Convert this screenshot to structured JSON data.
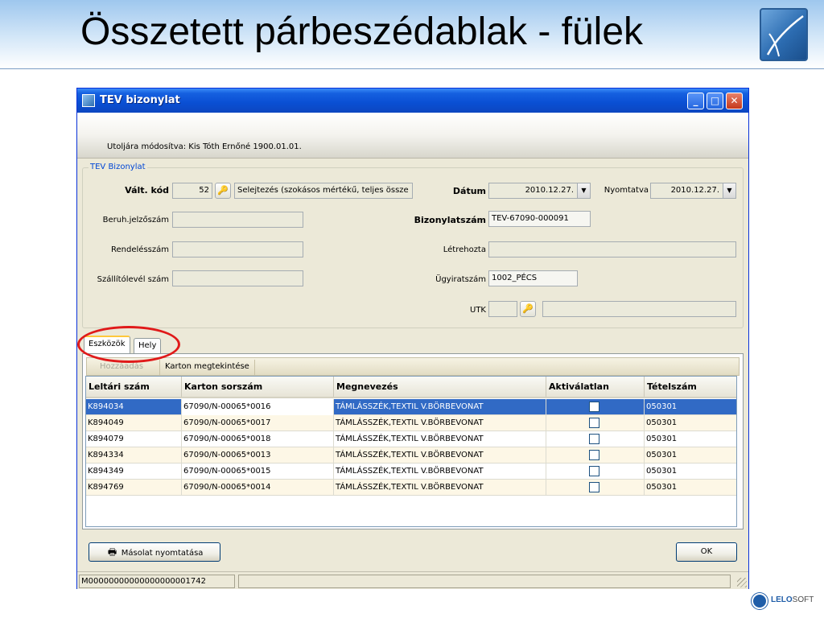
{
  "slide": {
    "title": "Összetett párbeszédablak - fülek"
  },
  "window": {
    "title": "TEV bizonylat",
    "modified_info": "Utoljára módosítva: Kis Tóth Ernőné 1900.01.01.",
    "fieldset_legend": "TEV Bizonylat"
  },
  "form": {
    "valt_kod": {
      "label": "Vált. kód",
      "value": "52",
      "description": "Selejtezés (szokásos mértékű, teljes össze"
    },
    "beruh": {
      "label": "Beruh.jelzőszám",
      "value": ""
    },
    "rendeles": {
      "label": "Rendelésszám",
      "value": ""
    },
    "szallito": {
      "label": "Szállítólevél szám",
      "value": ""
    },
    "datum": {
      "label": "Dátum",
      "value": "2010.12.27."
    },
    "nyomtatva": {
      "label": "Nyomtatva",
      "value": "2010.12.27."
    },
    "bizonylatszam": {
      "label": "Bizonylatszám",
      "value": "TEV-67090-000091"
    },
    "letrehozta": {
      "label": "Létrehozta",
      "value": ""
    },
    "ugyiratszam": {
      "label": "Ügyiratszám",
      "value": "1002_PÉCS"
    },
    "utk": {
      "label": "UTK",
      "value": "",
      "description": ""
    }
  },
  "tabs": [
    {
      "label": "Eszközök"
    },
    {
      "label": "Hely"
    }
  ],
  "toolbar": {
    "add_label": "Hozzáadás",
    "view_label": "Karton megtekintése"
  },
  "grid": {
    "columns": [
      "Leltári szám",
      "Karton sorszám",
      "Megnevezés",
      "Aktiválatlan",
      "Tételszám"
    ],
    "rows": [
      {
        "leltari": "K894034",
        "karton": "67090/N-00065*0016",
        "megnevezes": "TÁMLÁSSZÉK,TEXTIL V.BÖRBEVONAT",
        "tetel": "050301"
      },
      {
        "leltari": "K894049",
        "karton": "67090/N-00065*0017",
        "megnevezes": "TÁMLÁSSZÉK,TEXTIL V.BÖRBEVONAT",
        "tetel": "050301"
      },
      {
        "leltari": "K894079",
        "karton": "67090/N-00065*0018",
        "megnevezes": "TÁMLÁSSZÉK,TEXTIL V.BÖRBEVONAT",
        "tetel": "050301"
      },
      {
        "leltari": "K894334",
        "karton": "67090/N-00065*0013",
        "megnevezes": "TÁMLÁSSZÉK,TEXTIL V.BÖRBEVONAT",
        "tetel": "050301"
      },
      {
        "leltari": "K894349",
        "karton": "67090/N-00065*0015",
        "megnevezes": "TÁMLÁSSZÉK,TEXTIL V.BÖRBEVONAT",
        "tetel": "050301"
      },
      {
        "leltari": "K894769",
        "karton": "67090/N-00065*0014",
        "megnevezes": "TÁMLÁSSZÉK,TEXTIL V.BÖRBEVONAT",
        "tetel": "050301"
      }
    ]
  },
  "buttons": {
    "print_copy": "Másolat nyomtatása",
    "ok": "OK"
  },
  "status": {
    "code": "M00000000000000000001742"
  },
  "brand": {
    "name_bold": "LELO",
    "name_rest": "SOFT"
  },
  "icons": [
    "app-logo-icon",
    "window-icon",
    "key-icon",
    "dropdown-arrow-icon",
    "printer-icon",
    "checkbox-icon"
  ],
  "colors": {
    "title_bar": "#0a4fd3",
    "selection": "#316ac5",
    "highlight_circle": "#e01a1a",
    "accent_tab": "#ffc83c"
  }
}
